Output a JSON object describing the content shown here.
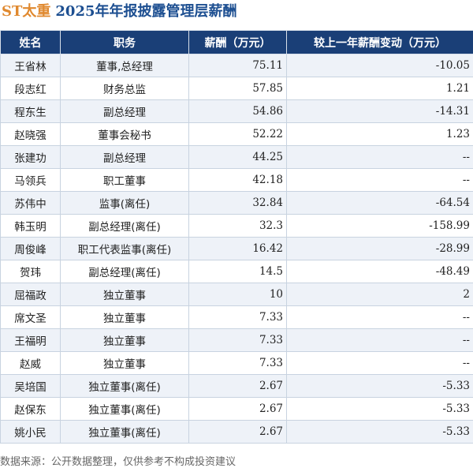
{
  "title": {
    "company": "ST太重",
    "subtitle": "2025年年报披露管理层薪酬"
  },
  "table": {
    "headers": {
      "name": "姓名",
      "position": "职务",
      "pay": "薪酬（万元）",
      "change": "较上一年薪酬变动（万元）"
    },
    "rows": [
      {
        "name": "王省林",
        "position": "董事,总经理",
        "pay": "75.11",
        "change": "-10.05"
      },
      {
        "name": "段志红",
        "position": "财务总监",
        "pay": "57.85",
        "change": "1.21"
      },
      {
        "name": "程东生",
        "position": "副总经理",
        "pay": "54.86",
        "change": "-14.31"
      },
      {
        "name": "赵晓强",
        "position": "董事会秘书",
        "pay": "52.22",
        "change": "1.23"
      },
      {
        "name": "张建功",
        "position": "副总经理",
        "pay": "44.25",
        "change": "--"
      },
      {
        "name": "马领兵",
        "position": "职工董事",
        "pay": "42.18",
        "change": "--"
      },
      {
        "name": "苏伟中",
        "position": "监事(离任)",
        "pay": "32.84",
        "change": "-64.54"
      },
      {
        "name": "韩玉明",
        "position": "副总经理(离任)",
        "pay": "32.3",
        "change": "-158.99"
      },
      {
        "name": "周俊峰",
        "position": "职工代表监事(离任)",
        "pay": "16.42",
        "change": "-28.99"
      },
      {
        "name": "贺玮",
        "position": "副总经理(离任)",
        "pay": "14.5",
        "change": "-48.49"
      },
      {
        "name": "屈福政",
        "position": "独立董事",
        "pay": "10",
        "change": "2"
      },
      {
        "name": "席文圣",
        "position": "独立董事",
        "pay": "7.33",
        "change": "--"
      },
      {
        "name": "王福明",
        "position": "独立董事",
        "pay": "7.33",
        "change": "--"
      },
      {
        "name": "赵威",
        "position": "独立董事",
        "pay": "7.33",
        "change": "--"
      },
      {
        "name": "吴培国",
        "position": "独立董事(离任)",
        "pay": "2.67",
        "change": "-5.33"
      },
      {
        "name": "赵保东",
        "position": "独立董事(离任)",
        "pay": "2.67",
        "change": "-5.33"
      },
      {
        "name": "姚小民",
        "position": "独立董事(离任)",
        "pay": "2.67",
        "change": "-5.33"
      }
    ]
  },
  "footer": "数据来源：公开数据整理，仅供参考不构成投资建议",
  "colors": {
    "header_bg": "#1a3f77",
    "company_title": "#e0892f",
    "subtitle": "#1d4f91",
    "negative_change": "#3a9a3a",
    "positive_change": "#d42020",
    "row_stripe": "#eef2f8"
  }
}
